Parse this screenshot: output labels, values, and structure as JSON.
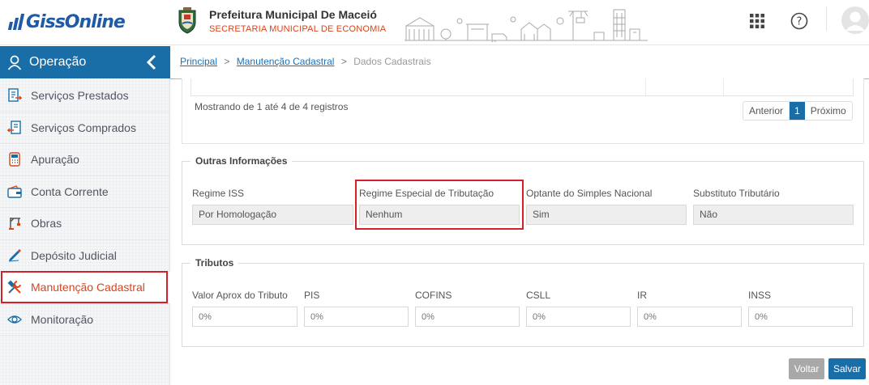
{
  "app": {
    "logo_text": "GissOnline"
  },
  "header": {
    "title": "Prefeitura Municipal De Maceió",
    "subtitle": "SECRETARIA MUNICIPAL DE ECONOMIA"
  },
  "sidebar": {
    "section_label": "Operação",
    "items": [
      {
        "label": "Serviços Prestados",
        "icon": "document-out-icon"
      },
      {
        "label": "Serviços Comprados",
        "icon": "document-in-icon"
      },
      {
        "label": "Apuração",
        "icon": "calculator-icon"
      },
      {
        "label": "Conta Corrente",
        "icon": "wallet-icon"
      },
      {
        "label": "Obras",
        "icon": "crane-icon"
      },
      {
        "label": "Depósito Judicial",
        "icon": "pen-icon"
      },
      {
        "label": "Manutenção Cadastral",
        "icon": "tools-icon",
        "active": true
      },
      {
        "label": "Monitoração",
        "icon": "eye-icon"
      }
    ]
  },
  "breadcrumb": {
    "home": "Principal",
    "section": "Manutenção Cadastral",
    "current": "Dados Cadastrais",
    "separator": ">"
  },
  "table_footer": {
    "showing": "Mostrando de 1 até 4 de 4 registros",
    "prev": "Anterior",
    "page": "1",
    "next": "Próximo"
  },
  "outras": {
    "legend": "Outras Informações",
    "fields": [
      {
        "label": "Regime ISS",
        "value": "Por Homologação"
      },
      {
        "label": "Regime Especial de Tributação",
        "value": "Nenhum"
      },
      {
        "label": "Optante do Simples Nacional",
        "value": "Sim"
      },
      {
        "label": "Substituto Tributário",
        "value": "Não"
      }
    ]
  },
  "tributos": {
    "legend": "Tributos",
    "fields": [
      {
        "label": "Valor Aprox do Tributo",
        "placeholder": "0%"
      },
      {
        "label": "PIS",
        "placeholder": "0%"
      },
      {
        "label": "COFINS",
        "placeholder": "0%"
      },
      {
        "label": "CSLL",
        "placeholder": "0%"
      },
      {
        "label": "IR",
        "placeholder": "0%"
      },
      {
        "label": "INSS",
        "placeholder": "0%"
      }
    ]
  },
  "actions": {
    "back": "Voltar",
    "save": "Salvar"
  },
  "colors": {
    "brand_blue": "#1a6ea8",
    "accent_orange": "#d9441c",
    "highlight_red": "#d3212c"
  }
}
